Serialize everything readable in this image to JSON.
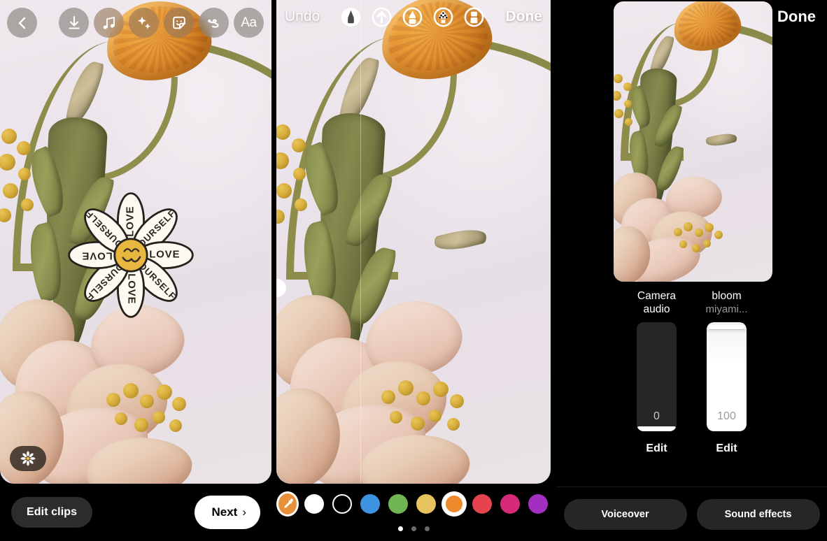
{
  "panels": {
    "editor": {
      "name": "story-editor",
      "toolbar": [
        {
          "icon": "back-chevron-icon",
          "label": "Back"
        },
        {
          "icon": "download-icon",
          "label": "Save"
        },
        {
          "icon": "music-note-icon",
          "label": "Music"
        },
        {
          "icon": "sparkles-icon",
          "label": "Effects"
        },
        {
          "icon": "sticker-smiley-icon",
          "label": "Stickers"
        },
        {
          "icon": "squiggle-draw-icon",
          "label": "Draw"
        },
        {
          "icon": "text-aa-icon",
          "label": "Text"
        }
      ],
      "fx_pill": {
        "icon": "daisy-flower-icon",
        "label": "Effects"
      },
      "sticker": {
        "name": "love-yourself-daisy-sticker",
        "petal_labels": [
          "LOVE",
          "YOURSELF",
          "LOVE",
          "YOURSELF",
          "LOVE",
          "YOURSELF",
          "LOVE",
          "YOURSELF"
        ],
        "center_color": "#e8b73f",
        "petal_color": "#fdfaf2"
      },
      "edit_clips_label": "Edit clips",
      "next_label": "Next",
      "next_chevron": "›"
    },
    "draw": {
      "name": "draw-mode",
      "undo_label": "Undo",
      "done_label": "Done",
      "tools": [
        {
          "icon": "pen-tool-icon",
          "label": "Pen",
          "selected": true
        },
        {
          "icon": "arrow-tool-icon",
          "label": "Arrow",
          "selected": false
        },
        {
          "icon": "marker-tool-icon",
          "label": "Marker",
          "selected": false
        },
        {
          "icon": "neon-glitter-tool-icon",
          "label": "Neon",
          "selected": false
        },
        {
          "icon": "eraser-tool-icon",
          "label": "Eraser",
          "selected": false
        }
      ],
      "colors": [
        {
          "name": "eyedropper",
          "hex": "#e8903a",
          "type": "eyedropper",
          "selected": false
        },
        {
          "name": "white",
          "hex": "#ffffff",
          "type": "solid",
          "selected": false
        },
        {
          "name": "black",
          "hex": "#000000",
          "type": "outline",
          "selected": false
        },
        {
          "name": "blue",
          "hex": "#3d93e0",
          "type": "solid",
          "selected": false
        },
        {
          "name": "green",
          "hex": "#6fb552",
          "type": "solid",
          "selected": false
        },
        {
          "name": "yellow",
          "hex": "#e6c35c",
          "type": "solid",
          "selected": false
        },
        {
          "name": "orange",
          "hex": "#ec8a2c",
          "type": "solid",
          "selected": true
        },
        {
          "name": "red",
          "hex": "#e5444f",
          "type": "solid",
          "selected": false
        },
        {
          "name": "pink",
          "hex": "#d52a78",
          "type": "solid",
          "selected": false
        },
        {
          "name": "purple",
          "hex": "#a32fc0",
          "type": "solid",
          "selected": false
        }
      ],
      "page_dots": {
        "count": 3,
        "active_index": 0
      },
      "drawing": {
        "name": "orange-smiley-doodle",
        "stroke_hex": "#ef8f33"
      }
    },
    "audio": {
      "name": "audio-mixer",
      "done_label": "Done",
      "tracks": [
        {
          "title_line1": "Camera",
          "title_line2": "audio",
          "subtitle": "",
          "value": "0",
          "level_percent": 0,
          "edit_label": "Edit"
        },
        {
          "title_line1": "bloom",
          "title_line2": "",
          "subtitle": "miyami...",
          "value": "100",
          "level_percent": 100,
          "edit_label": "Edit"
        }
      ],
      "actions": [
        {
          "label": "Voiceover",
          "name": "voiceover-button"
        },
        {
          "label": "Sound effects",
          "name": "sound-effects-button"
        }
      ]
    }
  }
}
